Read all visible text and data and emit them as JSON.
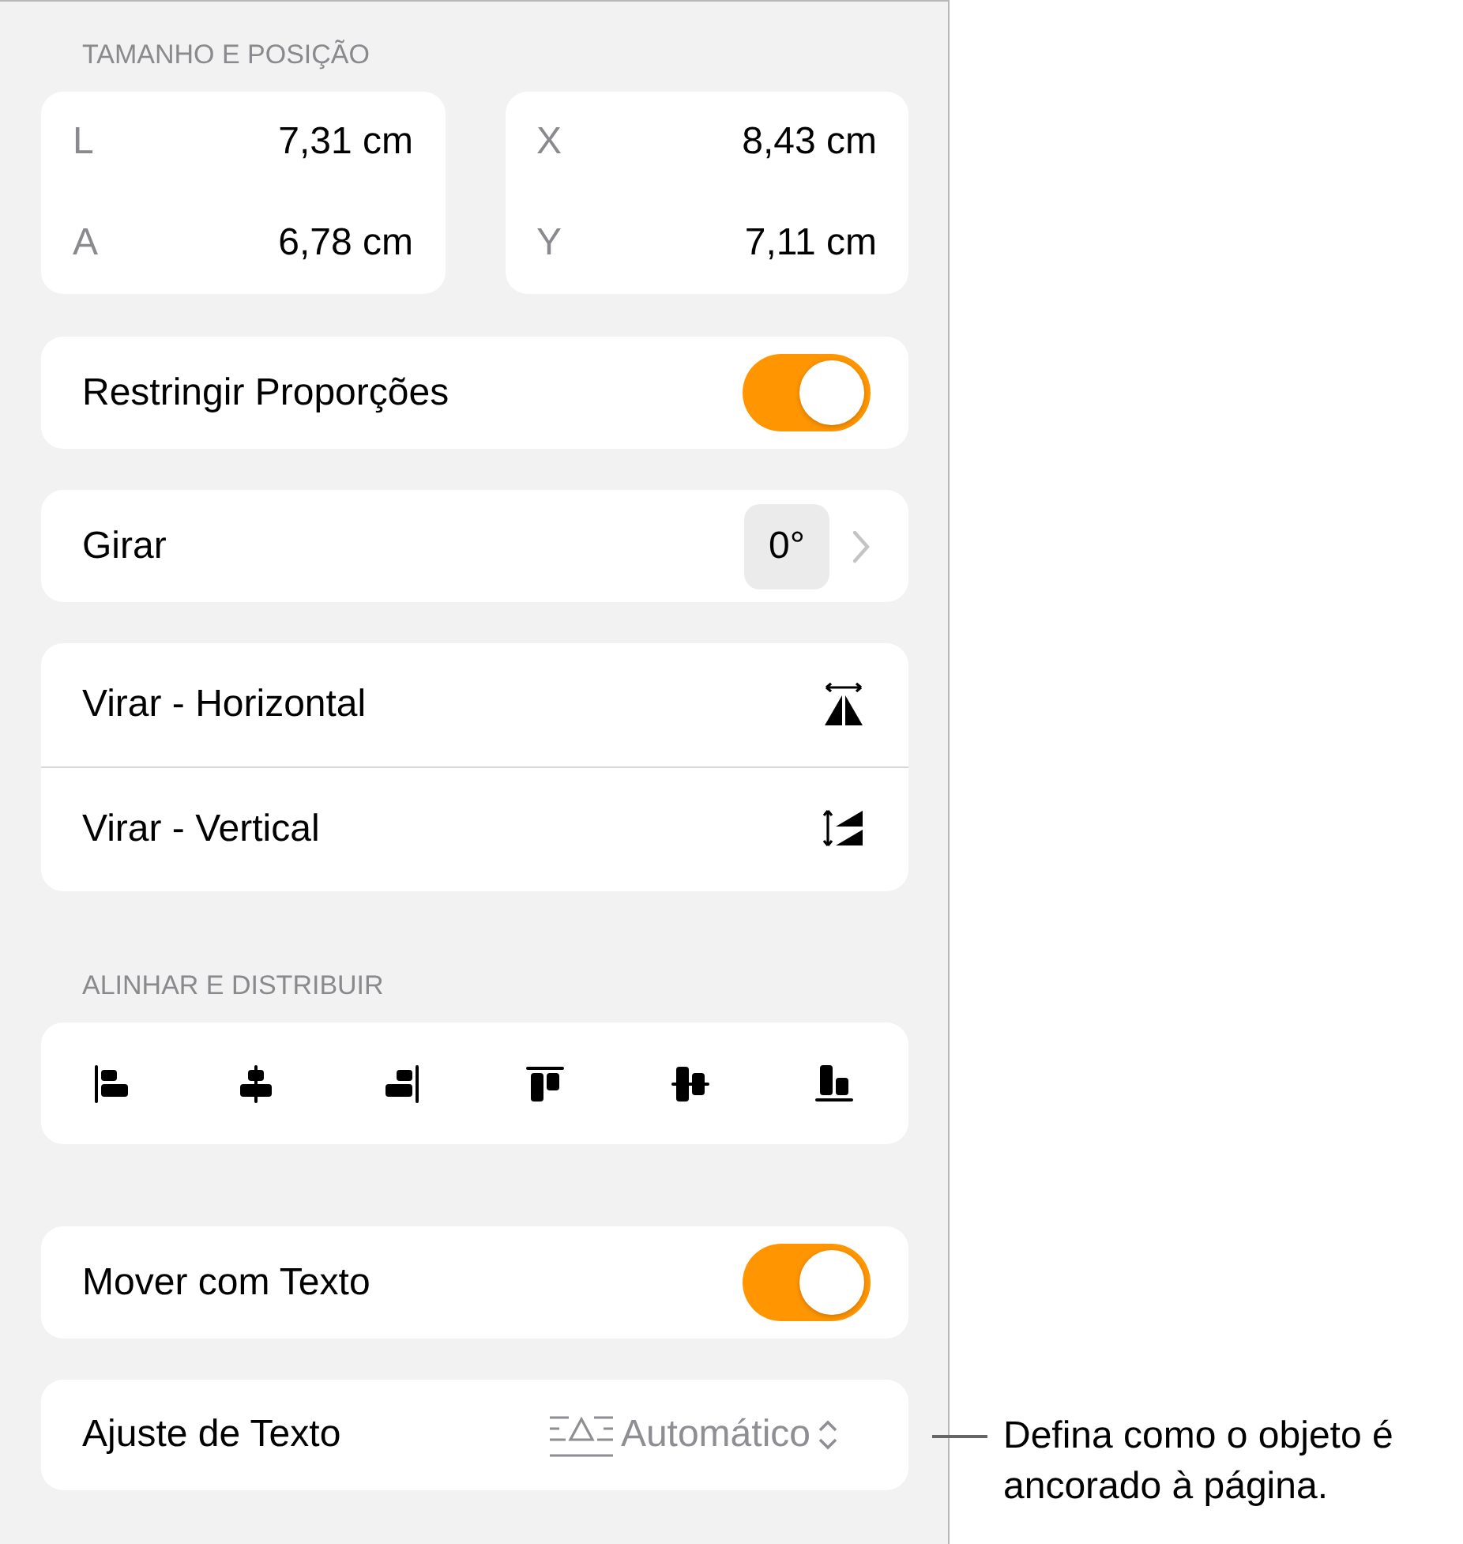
{
  "size_position": {
    "header": "TAMANHO E POSIÇÃO",
    "groups": [
      {
        "fields": [
          {
            "label": "L",
            "value": "7,31 cm"
          },
          {
            "label": "A",
            "value": "6,78 cm"
          }
        ]
      },
      {
        "fields": [
          {
            "label": "X",
            "value": "8,43 cm"
          },
          {
            "label": "Y",
            "value": "7,11 cm"
          }
        ]
      }
    ]
  },
  "constrain": {
    "label": "Restringir Proporções",
    "on": true
  },
  "rotate": {
    "label": "Girar",
    "value": "0°"
  },
  "flip": [
    {
      "label": "Virar - Horizontal",
      "kind": "horizontal"
    },
    {
      "label": "Virar - Vertical",
      "kind": "vertical"
    }
  ],
  "align": {
    "header": "ALINHAR E DISTRIBUIR",
    "buttons": [
      {
        "kind": "left"
      },
      {
        "kind": "center"
      },
      {
        "kind": "right"
      },
      {
        "kind": "top"
      },
      {
        "kind": "middle"
      },
      {
        "kind": "bottom"
      }
    ]
  },
  "move_with_text": {
    "label": "Mover com Texto",
    "on": true
  },
  "wrap": {
    "label": "Ajuste de Texto",
    "value": "Automático"
  },
  "callout": {
    "text": "Defina como o objeto é ancorado à página."
  }
}
